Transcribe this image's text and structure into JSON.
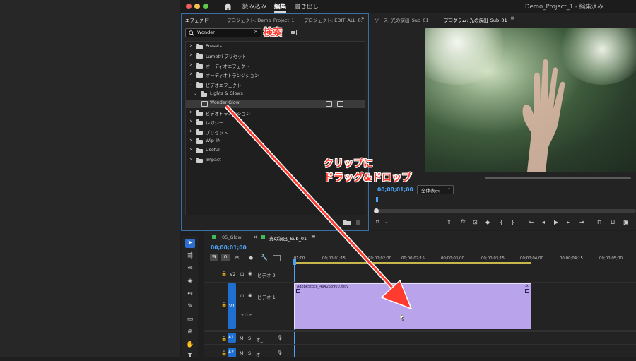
{
  "window": {
    "title": "Demo_Project_1 - 編集済み"
  },
  "menu": {
    "import": "読み込み",
    "edit": "編集",
    "export": "書き出し"
  },
  "effects_panel": {
    "tabs": [
      "エフェクト",
      "プロジェクト: Demo_Project_1",
      "プロジェクト: EDIT_ALL_0:",
      "»"
    ],
    "search_value": "Wonder",
    "clear": "×",
    "items": [
      {
        "label": "Presets",
        "level": 0,
        "expanded": false
      },
      {
        "label": "Lumetri プリセット",
        "level": 0,
        "expanded": false
      },
      {
        "label": "オーディオエフェクト",
        "level": 0,
        "expanded": false
      },
      {
        "label": "オーディオトランジション",
        "level": 0,
        "expanded": false
      },
      {
        "label": "ビデオエフェクト",
        "level": 0,
        "expanded": true
      },
      {
        "label": "Lights & Glows",
        "level": 1,
        "expanded": true
      },
      {
        "label": "Wonder Glow",
        "level": 2,
        "effect": true
      },
      {
        "label": "ビデオトランジション",
        "level": 0,
        "expanded": false
      },
      {
        "label": "レガシー",
        "level": 0,
        "expanded": false
      },
      {
        "label": "プリセット",
        "level": 0,
        "expanded": false
      },
      {
        "label": "Wip_IN",
        "level": 0,
        "expanded": false
      },
      {
        "label": "Useful",
        "level": 0,
        "expanded": false
      },
      {
        "label": "Impact",
        "level": 0,
        "expanded": false
      }
    ]
  },
  "source_tab": "ソース: 光の演出_Sub_01",
  "program_tab": "プログラム: 光の演出_Sub_01",
  "program": {
    "timecode": "00;00;01;00",
    "zoom": "全体表示"
  },
  "timeline": {
    "tabs": [
      "05_Glow",
      "光の演出_Sub_01"
    ],
    "timecode": "00;00;01;00",
    "ruler": [
      ";01;00",
      "00;00;01;15",
      "00;00;02;00",
      "00;00;02;15",
      "00;00;03;00",
      "00;00;03;15",
      "00;00;04;00",
      "00;00;04;15",
      "00;00;05;00"
    ],
    "tracks": {
      "v2": "V2",
      "v2_name": "ビデオ 2",
      "v1": "V1",
      "v1_name": "ビデオ 1",
      "a1": "A1",
      "a2": "A2",
      "m": "M",
      "s": "S",
      "o": "オ_"
    },
    "clip": {
      "name": "AdobeStock_494258900.mov",
      "fx": "fx"
    }
  },
  "annotations": {
    "search": "検索",
    "drag_line1": "クリップに",
    "drag_line2": "ドラッグ&ドロップ"
  },
  "colors": {
    "accent": "#4ea3f5",
    "clip": "#b9a3ea",
    "annotation": "#ff3a2e",
    "v1_target": "#1f6fd0"
  }
}
